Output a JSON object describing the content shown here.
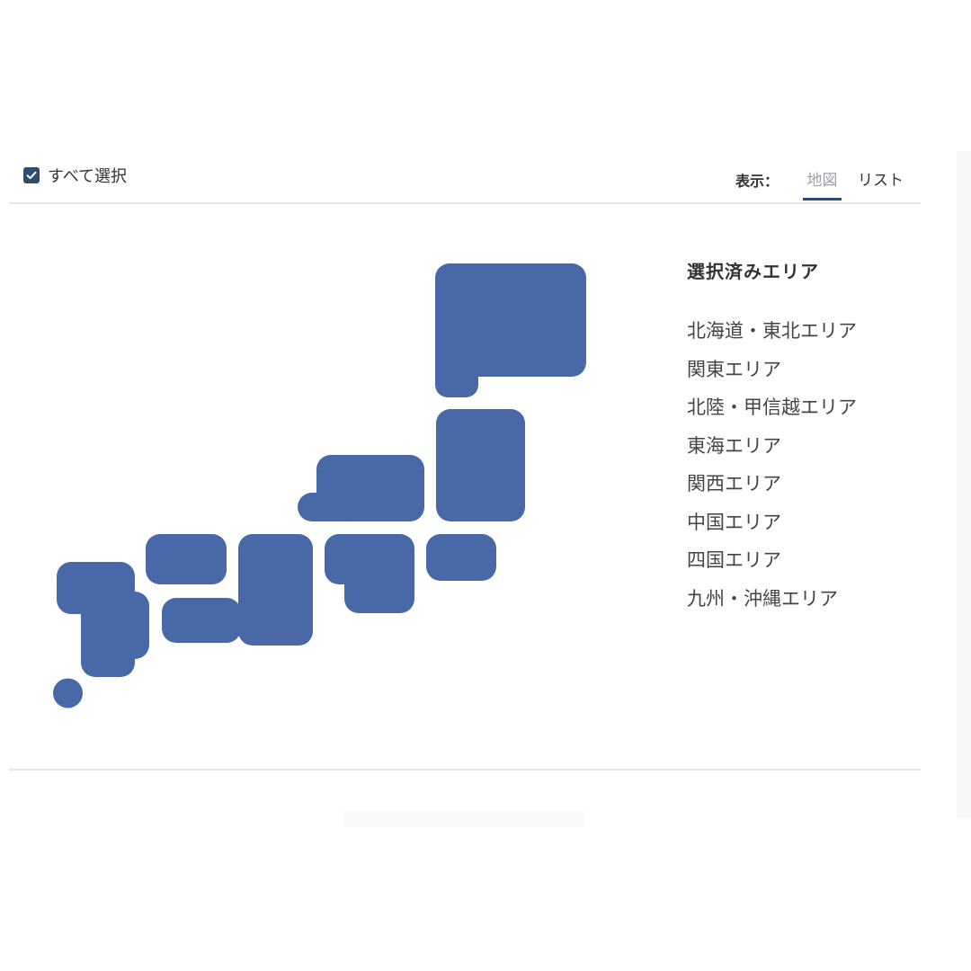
{
  "toolbar": {
    "select_all_label": "すべて選択",
    "select_all_checked": true,
    "view_label": "表示：",
    "tabs": [
      {
        "label": "地図",
        "active": true
      },
      {
        "label": "リスト",
        "active": false
      }
    ]
  },
  "map": {
    "region_color": "#4868a8"
  },
  "selected_areas": {
    "title": "選択済みエリア",
    "items": [
      "北海道・東北エリア",
      "関東エリア",
      "北陸・甲信越エリア",
      "東海エリア",
      "関西エリア",
      "中国エリア",
      "四国エリア",
      "九州・沖縄エリア"
    ]
  },
  "colors": {
    "accent": "#2f4b6d",
    "divider": "#e3e6ea",
    "text": "#333333",
    "tab_inactive": "#9aa0a6"
  }
}
